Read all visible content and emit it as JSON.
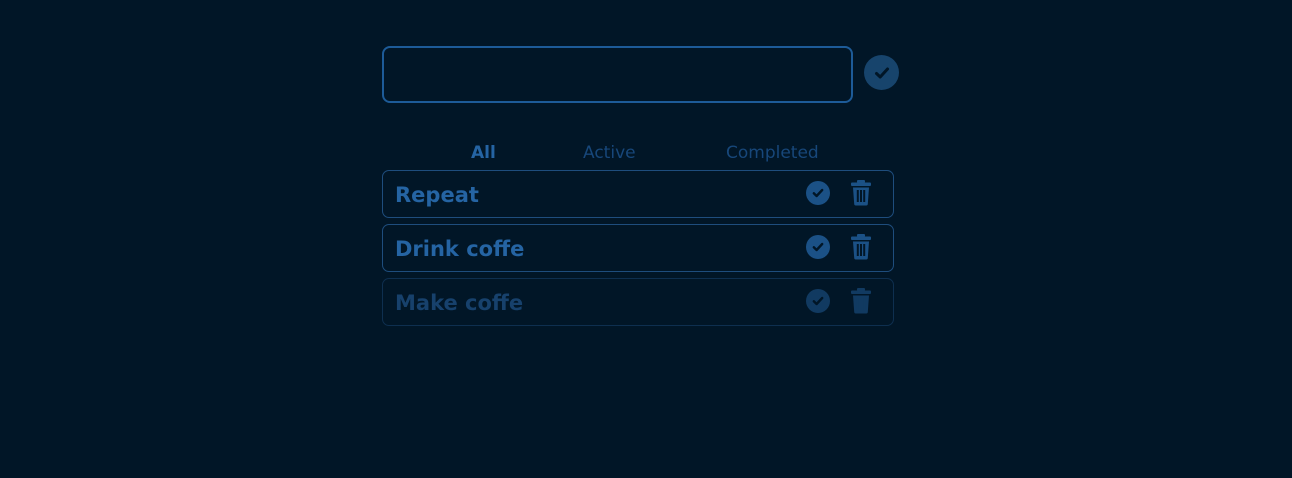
{
  "input": {
    "value": "",
    "placeholder": ""
  },
  "add_button_icon": "check-circle-icon",
  "filters": {
    "all": "All",
    "active": "Active",
    "completed": "Completed",
    "selected": "All"
  },
  "todos": [
    {
      "text": "Repeat",
      "completed": false
    },
    {
      "text": "Drink coffe",
      "completed": false
    },
    {
      "text": "Make coffe",
      "completed": true
    }
  ],
  "colors": {
    "background": "#011627",
    "accent": "#2564a3",
    "muted": "#17416c"
  },
  "icons": {
    "complete": "check-circle-icon",
    "delete": "trash-icon"
  }
}
